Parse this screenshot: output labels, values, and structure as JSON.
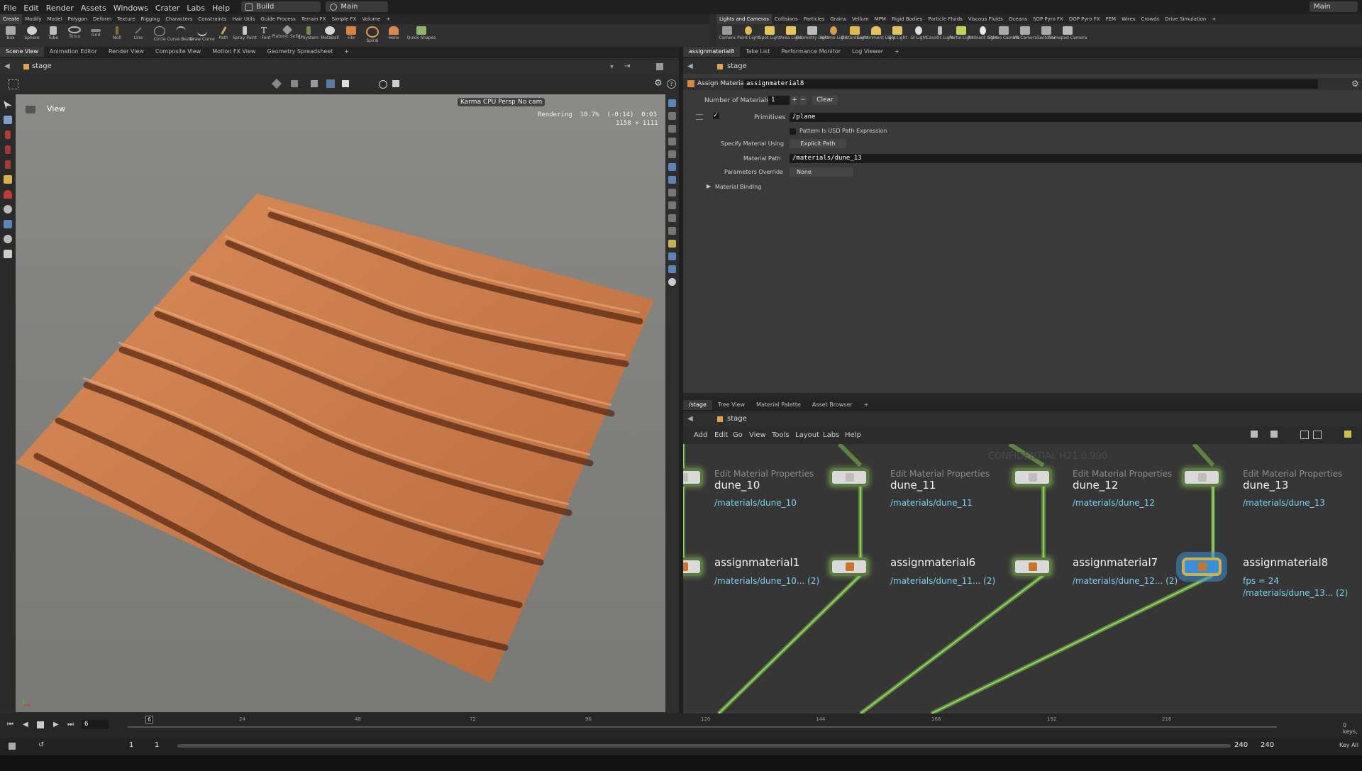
{
  "menubar": {
    "items": [
      "File",
      "Edit",
      "Render",
      "Assets",
      "Windows",
      "Crater",
      "Labs",
      "Help"
    ],
    "desktop": "Build",
    "context": "Main",
    "right_context": "Main"
  },
  "shelf_left": {
    "tabs": [
      "Create",
      "Modify",
      "Model",
      "Polygon",
      "Deform",
      "Texture",
      "Rigging",
      "Characters",
      "Constraints",
      "Hair Utils",
      "Guide Process",
      "Terrain FX",
      "Simple FX",
      "Volume"
    ],
    "tools": [
      "Box",
      "Sphere",
      "Tube",
      "Torus",
      "Grid",
      "Null",
      "Line",
      "Circle",
      "Curve Bezier",
      "Draw Curve",
      "Path",
      "Spray Paint",
      "Font",
      "Platonic Solids",
      "L-System",
      "Metaball",
      "File",
      "Spiral",
      "Helix",
      "Quick Shapes"
    ]
  },
  "shelf_right": {
    "tabs": [
      "Lights and Cameras",
      "Collisions",
      "Particles",
      "Grains",
      "Vellum",
      "MPM",
      "Rigid Bodies",
      "Particle Fluids",
      "Viscous Fluids",
      "Oceans",
      "SOP Pyro FX",
      "DOP Pyro FX",
      "FEM",
      "Wires",
      "Crowds",
      "Drive Simulation"
    ],
    "tools": [
      "Camera",
      "Point Light",
      "Spot Light",
      "Area Light",
      "Geometry Light",
      "Volume Light",
      "Distant Light",
      "Environment Light",
      "Sky Light",
      "GI Light",
      "Caustic Light",
      "Portal Light",
      "Ambient Light",
      "Stereo Camera",
      "VR Camera",
      "Switcher",
      "Gamepad Camera"
    ]
  },
  "left_pane": {
    "tabs": [
      "Scene View",
      "Animation Editor",
      "Render View",
      "Composite View",
      "Motion FX View",
      "Geometry Spreadsheet"
    ],
    "path": "stage",
    "view_label": "View",
    "renderer": "Karma CPU Persp",
    "camera": "No cam",
    "status_line1": "Rendering  18.7%  (-0:14)  0:03",
    "status_line2": "1158 × 1111"
  },
  "param_pane": {
    "tabs": [
      "assignmaterial8",
      "Take List",
      "Performance Monitor",
      "Log Viewer"
    ],
    "path": "stage",
    "node_type": "Assign Material",
    "node_name": "assignmaterial8",
    "num_materials_label": "Number of Materials",
    "num_materials_value": "1",
    "clear_label": "Clear",
    "primitives_label": "Primitives",
    "primitives_value": "/plane",
    "pattern_label": "Pattern Is USD Path Expression",
    "specify_label": "Specify Material Using",
    "specify_value": "Explicit Path",
    "material_path_label": "Material Path",
    "material_path_value": "/materials/dune_13",
    "params_override_label": "Parameters Override",
    "params_override_value": "None",
    "material_binding_label": "Material Binding"
  },
  "network_pane": {
    "tabs": [
      "/stage",
      "Tree View",
      "Material Palette",
      "Asset Browser"
    ],
    "path": "stage",
    "menu": [
      "Add",
      "Edit",
      "Go",
      "View",
      "Tools",
      "Layout",
      "Labs",
      "Help"
    ],
    "watermark": "CONFIDENTIAL H21.0.990",
    "edit_nodes": [
      {
        "type": "Edit Material Properties",
        "name": "dune_10",
        "path": "/materials/dune_10"
      },
      {
        "type": "Edit Material Properties",
        "name": "dune_11",
        "path": "/materials/dune_11"
      },
      {
        "type": "Edit Material Properties",
        "name": "dune_12",
        "path": "/materials/dune_12"
      },
      {
        "type": "Edit Material Properties",
        "name": "dune_13",
        "path": "/materials/dune_13"
      }
    ],
    "assign_nodes": [
      {
        "name": "assignmaterial1",
        "info": "",
        "path": "/materials/dune_10... (2)"
      },
      {
        "name": "assignmaterial6",
        "info": "",
        "path": "/materials/dune_11... (2)"
      },
      {
        "name": "assignmaterial7",
        "info": "",
        "path": "/materials/dune_12... (2)"
      },
      {
        "name": "assignmaterial8",
        "info": "fps = 24",
        "path": "/materials/dune_13... (2)"
      }
    ]
  },
  "timeline": {
    "current_frame": "6",
    "ticks": [
      "24",
      "48",
      "72",
      "96",
      "120",
      "144",
      "168",
      "192",
      "216"
    ],
    "start": "1",
    "start2": "1",
    "end": "240",
    "end2": "240",
    "keys": "0 keys,",
    "key_all": "Key All"
  },
  "colors": {
    "accent_green": "#7cc24a",
    "path_blue": "#79d3ee",
    "selected_node": "#3d8ed8",
    "sand": "#c97a4a"
  }
}
